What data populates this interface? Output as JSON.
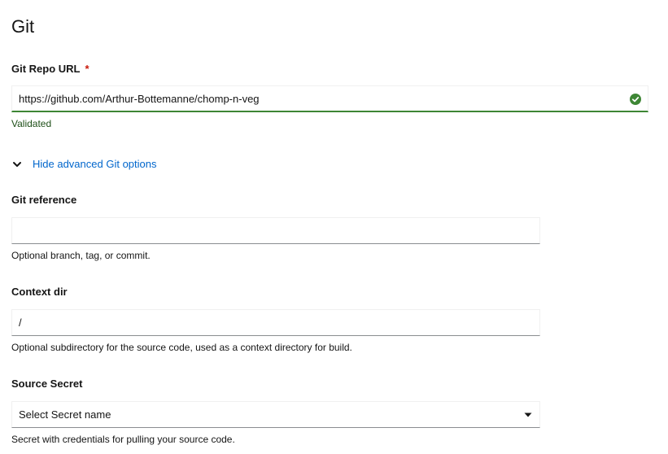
{
  "section": {
    "title": "Git"
  },
  "git_repo_url": {
    "label": "Git Repo URL",
    "required_marker": "*",
    "value": "https://github.com/Arthur-Bottemanne/chomp-n-veg",
    "status": "Validated",
    "status_icon": "check-circle-icon",
    "status_color": "#3e8635"
  },
  "advanced_toggle": {
    "label": "Hide advanced Git options",
    "icon": "chevron-down-icon",
    "color": "#0066cc"
  },
  "git_reference": {
    "label": "Git reference",
    "value": "",
    "helper": "Optional branch, tag, or commit."
  },
  "context_dir": {
    "label": "Context dir",
    "value": "/",
    "helper": "Optional subdirectory for the source code, used as a context directory for build."
  },
  "source_secret": {
    "label": "Source Secret",
    "selected": "Select Secret name",
    "icon": "caret-down-icon",
    "helper": "Secret with credentials for pulling your source code."
  }
}
